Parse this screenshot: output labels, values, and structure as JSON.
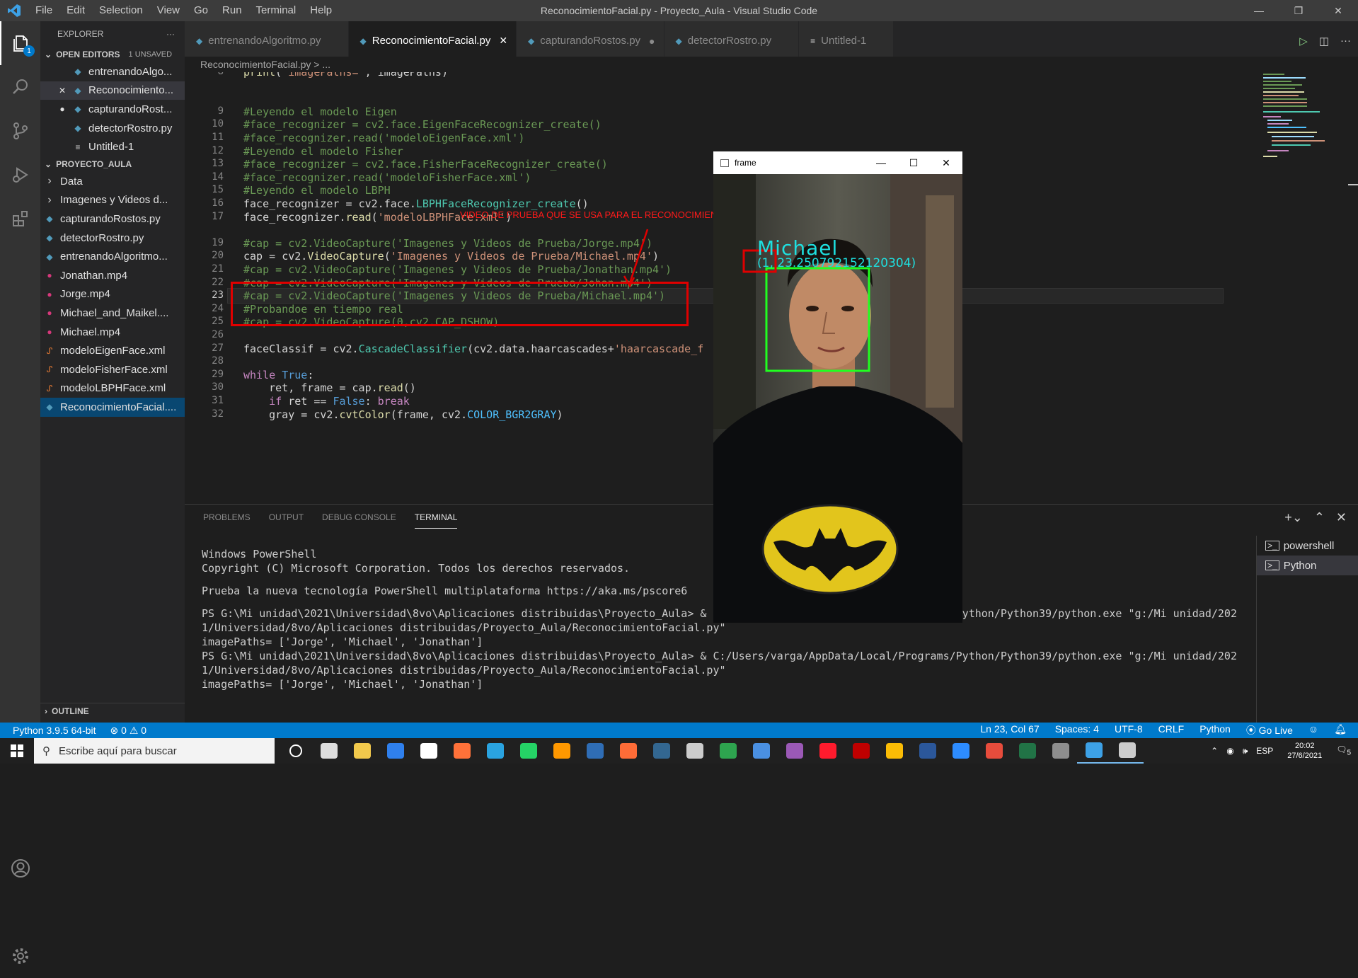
{
  "window": {
    "title": "ReconocimientoFacial.py - Proyecto_Aula - Visual Studio Code",
    "menu": [
      "File",
      "Edit",
      "Selection",
      "View",
      "Go",
      "Run",
      "Terminal",
      "Help"
    ]
  },
  "activity": {
    "badge": "1"
  },
  "explorer": {
    "title": "EXPLORER",
    "more": "···",
    "open_editors_label": "OPEN EDITORS",
    "unsaved": "1 UNSAVED",
    "open_editors": [
      {
        "name": "entrenandoAlgo...",
        "icon": "py"
      },
      {
        "name": "Reconocimiento...",
        "icon": "py",
        "close": "✕"
      },
      {
        "name": "capturandoRost...",
        "icon": "py",
        "dot": "●"
      },
      {
        "name": "detectorRostro.py",
        "icon": "py"
      },
      {
        "name": "Untitled-1",
        "icon": "txt"
      }
    ],
    "project_label": "PROYECTO_AULA",
    "files": [
      {
        "name": "Data",
        "icon": "folder"
      },
      {
        "name": "Imagenes y Videos d...",
        "icon": "folder"
      },
      {
        "name": "capturandoRostos.py",
        "icon": "py"
      },
      {
        "name": "detectorRostro.py",
        "icon": "py"
      },
      {
        "name": "entrenandoAlgoritmo...",
        "icon": "py"
      },
      {
        "name": "Jonathan.mp4",
        "icon": "mp4"
      },
      {
        "name": "Jorge.mp4",
        "icon": "mp4"
      },
      {
        "name": "Michael_and_Maikel....",
        "icon": "mp4"
      },
      {
        "name": "Michael.mp4",
        "icon": "mp4"
      },
      {
        "name": "modeloEigenFace.xml",
        "icon": "xml"
      },
      {
        "name": "modeloFisherFace.xml",
        "icon": "xml"
      },
      {
        "name": "modeloLBPHFace.xml",
        "icon": "xml"
      },
      {
        "name": "ReconocimientoFacial....",
        "icon": "py"
      }
    ],
    "outline_label": "OUTLINE"
  },
  "tabs": [
    {
      "label": "entrenandoAlgoritmo.py",
      "active": false,
      "mark": ""
    },
    {
      "label": "ReconocimientoFacial.py",
      "active": true,
      "mark": "✕"
    },
    {
      "label": "capturandoRostos.py",
      "active": false,
      "mark": "●"
    },
    {
      "label": "detectorRostro.py",
      "active": false,
      "mark": ""
    },
    {
      "label": "Untitled-1",
      "active": false,
      "mark": ""
    }
  ],
  "breadcrumb": "ReconocimientoFacial.py > ...",
  "editor": {
    "current_line": "23",
    "lines": [
      {
        "n": "8",
        "code": "print('imagePaths=', imagePaths)"
      },
      {
        "n": "",
        "code": ""
      },
      {
        "n": "",
        "code": ""
      },
      {
        "n": "9",
        "code": "#Leyendo el modelo Eigen"
      },
      {
        "n": "10",
        "code": "#face_recognizer = cv2.face.EigenFaceRecognizer_create()"
      },
      {
        "n": "11",
        "code": "#face_recognizer.read('modeloEigenFace.xml')"
      },
      {
        "n": "12",
        "code": "#Leyendo el modelo Fisher"
      },
      {
        "n": "13",
        "code": "#face_recognizer = cv2.face.FisherFaceRecognizer_create()"
      },
      {
        "n": "14",
        "code": "#face_recognizer.read('modeloFisherFace.xml')"
      },
      {
        "n": "15",
        "code": "#Leyendo el modelo LBPH"
      },
      {
        "n": "16",
        "code": "face_recognizer = cv2.face.LBPHFaceRecognizer_create()"
      },
      {
        "n": "17",
        "code": "face_recognizer.read('modeloLBPHFace.xml')"
      },
      {
        "n": "",
        "code": ""
      },
      {
        "n": "19",
        "code": "#cap = cv2.VideoCapture('Imagenes y Videos de Prueba/Jorge.mp4')"
      },
      {
        "n": "20",
        "code": "cap = cv2.VideoCapture('Imagenes y Videos de Prueba/Michael.mp4')"
      },
      {
        "n": "21",
        "code": "#cap = cv2.VideoCapture('Imagenes y Videos de Prueba/Jonathan.mp4')"
      },
      {
        "n": "22",
        "code": "#cap = cv2.VideoCapture('Imagenes y Videos de Prueba/Johan.mp4')"
      },
      {
        "n": "23",
        "code": "#cap = cv2.VideoCapture('Imagenes y Videos de Prueba/Michael.mp4')"
      },
      {
        "n": "24",
        "code": "#Probandoe en tiempo real"
      },
      {
        "n": "25",
        "code": "#cap = cv2.VideoCapture(0,cv2.CAP_DSHOW)"
      },
      {
        "n": "26",
        "code": ""
      },
      {
        "n": "27",
        "code": "faceClassif = cv2.CascadeClassifier(cv2.data.haarcascades+'haarcascade_f"
      },
      {
        "n": "28",
        "code": ""
      },
      {
        "n": "29",
        "code": "while True:"
      },
      {
        "n": "30",
        "code": "    ret, frame = cap.read()"
      },
      {
        "n": "31",
        "code": "    if ret == False: break"
      },
      {
        "n": "32",
        "code": "    gray = cv2.cvtColor(frame, cv2.COLOR_BGR2GRAY)"
      }
    ]
  },
  "annotation": "VIDEO DE PRUEBA QUE SE USA PARA EL RECONOCIMIENTO",
  "frame_window": {
    "title": "frame",
    "name_label": "Michael",
    "score_label": "(1, 23.250792152120304)"
  },
  "panel": {
    "tabs": [
      "PROBLEMS",
      "OUTPUT",
      "DEBUG CONSOLE",
      "TERMINAL"
    ],
    "active_tab": "TERMINAL",
    "terminal_lines": [
      "Windows PowerShell",
      "Copyright (C) Microsoft Corporation. Todos los derechos reservados.",
      "",
      "Prueba la nueva tecnología PowerShell multiplataforma https://aka.ms/pscore6",
      "",
      "PS G:\\Mi unidad\\2021\\Universidad\\8vo\\Aplicaciones distribuidas\\Proyecto_Aula> & C:/Users/varga/AppData/Local/Programs/Python/Python39/python.exe \"g:/Mi unidad/202",
      "1/Universidad/8vo/Aplicaciones distribuidas/Proyecto_Aula/ReconocimientoFacial.py\"",
      "imagePaths= ['Jorge', 'Michael', 'Jonathan']",
      "PS G:\\Mi unidad\\2021\\Universidad\\8vo\\Aplicaciones distribuidas\\Proyecto_Aula> & C:/Users/varga/AppData/Local/Programs/Python/Python39/python.exe \"g:/Mi unidad/202",
      "1/Universidad/8vo/Aplicaciones distribuidas/Proyecto_Aula/ReconocimientoFacial.py\"",
      "imagePaths= ['Jorge', 'Michael', 'Jonathan']"
    ],
    "terminals": [
      "powershell",
      "Python"
    ]
  },
  "status": {
    "python": "Python 3.9.5 64-bit",
    "problems": "⊗ 0 ⚠ 0",
    "position": "Ln 23, Col 67",
    "spaces": "Spaces: 4",
    "encoding": "UTF-8",
    "eol": "CRLF",
    "language": "Python",
    "golive": "Go Live"
  },
  "taskbar": {
    "search_placeholder": "Escribe aquí para buscar",
    "lang": "ESP",
    "time": "20:02",
    "date": "27/6/2021",
    "notif": "5"
  }
}
